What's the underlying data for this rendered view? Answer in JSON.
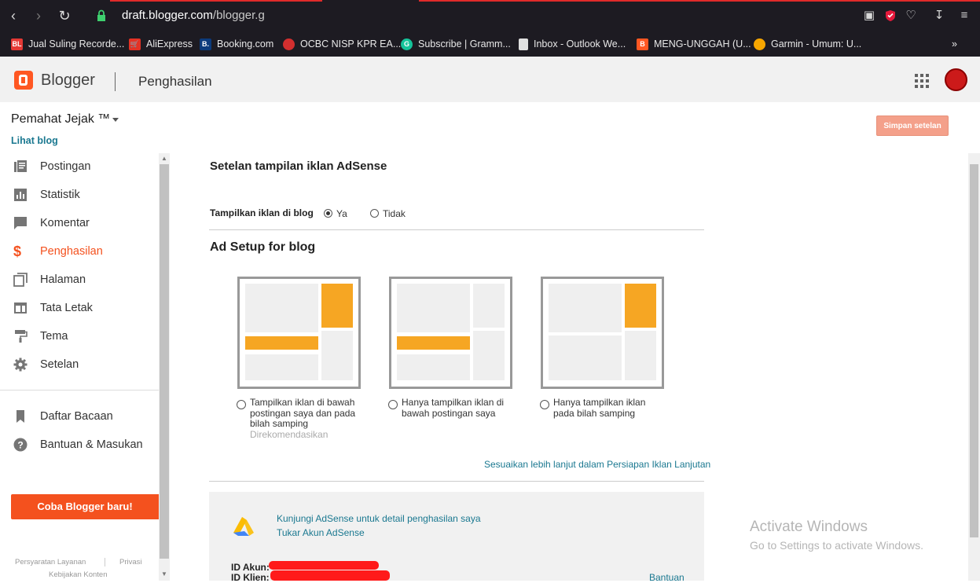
{
  "browser": {
    "url_host": "draft.blogger.com",
    "url_path": "/blogger.g",
    "bookmarks": [
      {
        "label": "Jual Suling Recorde...",
        "favicon": "BL",
        "color": "#e53935"
      },
      {
        "label": "AliExpress",
        "favicon": "cart",
        "color": "#e43225"
      },
      {
        "label": "Booking.com",
        "favicon": "B.",
        "color": "#0c3b7c"
      },
      {
        "label": "OCBC NISP KPR EA...",
        "favicon": "ocbc",
        "color": "#d32f2f"
      },
      {
        "label": "Subscribe | Gramm...",
        "favicon": "G",
        "color": "#15c39a"
      },
      {
        "label": "Inbox - Outlook We...",
        "favicon": "doc",
        "color": "#e0e0e0"
      },
      {
        "label": "MENG-UNGGAH (U...",
        "favicon": "B",
        "color": "#ff5722"
      },
      {
        "label": "Garmin - Umum: U...",
        "favicon": "garmin",
        "color": "#f7a600"
      }
    ],
    "more_bookmarks": "»"
  },
  "header": {
    "brand": "Blogger",
    "section": "Penghasilan"
  },
  "sidebar": {
    "blog_name": "Pemahat Jejak ™",
    "view_blog": "Lihat blog",
    "items": [
      {
        "label": "Postingan",
        "icon": "posts-icon"
      },
      {
        "label": "Statistik",
        "icon": "stats-icon"
      },
      {
        "label": "Komentar",
        "icon": "comment-icon"
      },
      {
        "label": "Penghasilan",
        "icon": "dollar-icon",
        "active": true
      },
      {
        "label": "Halaman",
        "icon": "pages-icon"
      },
      {
        "label": "Tata Letak",
        "icon": "layout-icon"
      },
      {
        "label": "Tema",
        "icon": "paint-roller-icon"
      },
      {
        "label": "Setelan",
        "icon": "gear-icon"
      }
    ],
    "items2": [
      {
        "label": "Daftar Bacaan",
        "icon": "bookmark-icon"
      },
      {
        "label": "Bantuan & Masukan",
        "icon": "help-icon"
      }
    ],
    "try_new": "Coba Blogger baru!",
    "footer": {
      "terms": "Persyaratan Layanan",
      "privacy": "Privasi",
      "content_policy": "Kebijakan Konten"
    }
  },
  "main": {
    "save_button": "Simpan setelan",
    "title": "Setelan tampilan iklan AdSense",
    "show_ads_label": "Tampilkan iklan di blog",
    "show_ads_yes": "Ya",
    "show_ads_no": "Tidak",
    "show_ads_selected": "Ya",
    "ad_setup_title": "Ad Setup for blog",
    "options": [
      {
        "label": "Tampilkan iklan di bawah postingan saya dan pada bilah samping",
        "note": "Direkomendasikan"
      },
      {
        "label": "Hanya tampilkan iklan di bawah postingan saya",
        "note": ""
      },
      {
        "label": "Hanya tampilkan iklan pada bilah samping",
        "note": ""
      }
    ],
    "advanced_link": "Sesuaikan lebih lanjut dalam Persiapan Iklan Lanjutan",
    "adsense": {
      "visit_link": "Kunjungi AdSense untuk detail penghasilan saya",
      "switch_link": "Tukar Akun AdSense",
      "account_id_label": "ID Akun:",
      "client_id_label": "ID Klien:",
      "help_link": "Bantuan"
    }
  },
  "watermark": {
    "line1": "Activate Windows",
    "line2": "Go to Settings to activate Windows."
  },
  "colors": {
    "accent": "#f4511e",
    "ad_block": "#f6a623",
    "link": "#1a7890"
  }
}
